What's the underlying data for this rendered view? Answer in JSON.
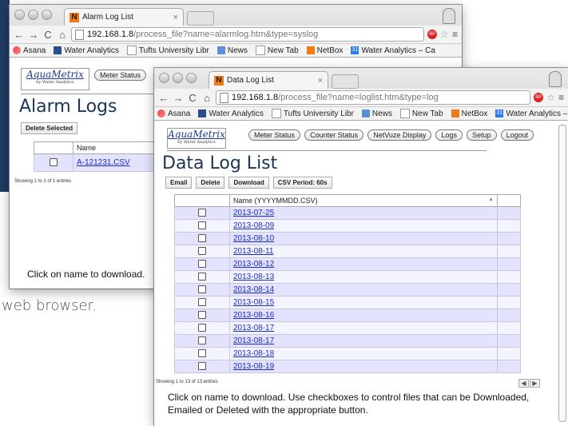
{
  "caption": "web browser.",
  "back_window": {
    "tab_title": "Alarm Log List",
    "url_host": "192.168.1.8",
    "url_path": "/process_file?name=alarmlog.htm&type=syslog",
    "bookmarks": [
      "Asana",
      "Water Analytics",
      "Tufts University Libr",
      "News",
      "New Tab",
      "NetBox",
      "Water Analytics – Ca"
    ],
    "logo_main": "AquaMetrix",
    "logo_sub": "by Water Analytics",
    "nav_first": "Meter Status",
    "page_title": "Alarm Logs",
    "delete_label": "Delete Selected",
    "col_name": "Name",
    "rows": [
      "A-121231.CSV"
    ],
    "showing": "Showing 1 to 1 of 1 entries",
    "footer": "Click on name to download."
  },
  "front_window": {
    "tab_title": "Data Log List",
    "url_host": "192.168.1.8",
    "url_path": "/process_file?name=loglist.htm&type=log",
    "bookmarks": [
      "Asana",
      "Water Analytics",
      "Tufts University Libr",
      "News",
      "New Tab",
      "NetBox",
      "Water Analytics – Ca"
    ],
    "logo_main": "AquaMetrix",
    "logo_sub": "by Water Analytics",
    "nav": [
      "Meter Status",
      "Counter Status",
      "NetVuze Display",
      "Logs",
      "Setup",
      "Logout"
    ],
    "page_title": "Data Log List",
    "actions": [
      "Email",
      "Delete",
      "Download",
      "CSV Period: 60s"
    ],
    "col_name": "Name (YYYYMMDD.CSV)",
    "rows": [
      "2013-07-25",
      "2013-08-09",
      "2013-08-10",
      "2013-08-11",
      "2013-08-12",
      "2013-08-13",
      "2013-08-14",
      "2013-08-15",
      "2013-08-16",
      "2013-08-17",
      "2013-08-17",
      "2013-08-18",
      "2013-08-19"
    ],
    "showing": "Showing 1 to 13 of 13 entries",
    "footer": "Click on name to download. Use checkboxes to control files that can be Downloaded, Emailed or Deleted with the appropriate button."
  }
}
